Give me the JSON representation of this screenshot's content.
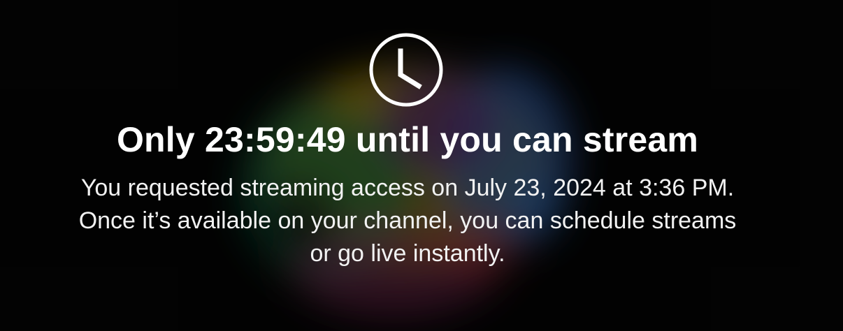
{
  "colors": {
    "background": "#050505",
    "text": "#ffffff",
    "secondary_text": "#f2f2f2",
    "art_yellow": "#a68a00",
    "art_blue": "#2f63b8",
    "art_green": "#177a4f",
    "art_purple": "#5a2b7d",
    "art_pink": "#8e2f62"
  },
  "icon": {
    "name": "clock-icon"
  },
  "notice": {
    "title": "Only 23:59:49 until you can stream",
    "description": "You requested streaming access on July 23, 2024 at 3:36 PM. Once it’s available on your channel, you can schedule streams or go live instantly."
  }
}
